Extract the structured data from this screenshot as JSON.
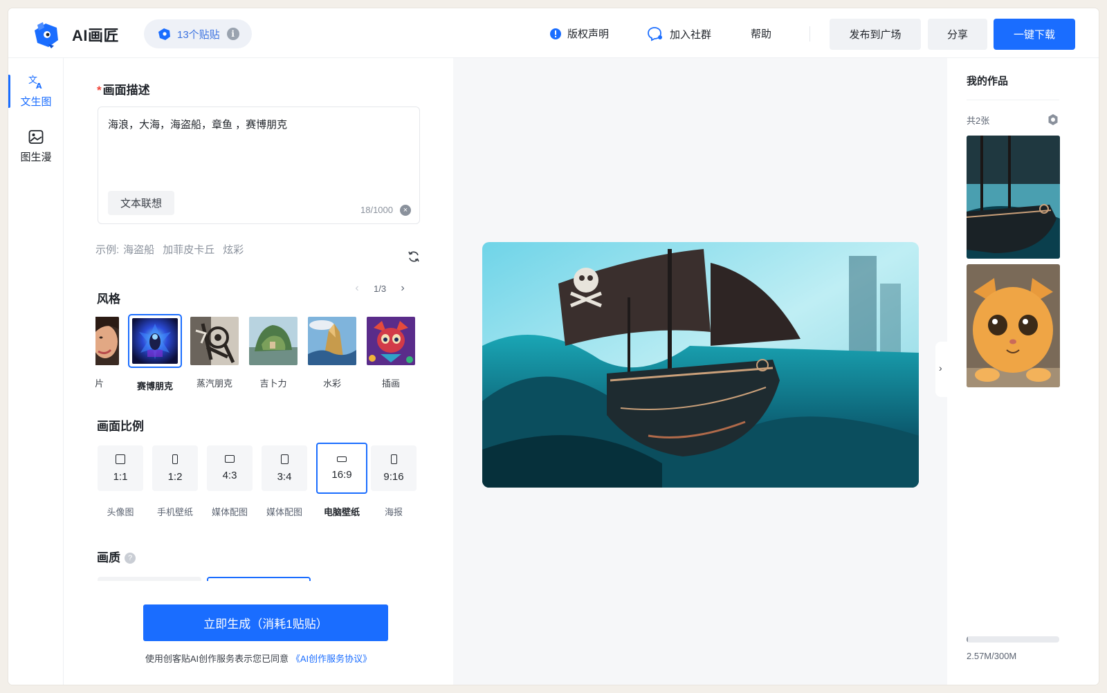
{
  "header": {
    "app_title": "AI画匠",
    "credits_label": "13个贴贴",
    "nav": {
      "copyright": "版权声明",
      "community": "加入社群",
      "help": "帮助"
    },
    "buttons": {
      "publish": "发布到广场",
      "share": "分享",
      "download": "一键下载"
    }
  },
  "rail": {
    "items": [
      {
        "label": "文生图",
        "icon": "translate-icon",
        "active": true
      },
      {
        "label": "图生漫",
        "icon": "image-icon",
        "active": false
      }
    ]
  },
  "prompt": {
    "title": "画面描述",
    "value": "海浪，大海，海盗船，章鱼 ，赛博朋克",
    "assoc_button": "文本联想",
    "counter": "18/1000",
    "clear_glyph": "×"
  },
  "examples": {
    "prefix": "示例:",
    "items": [
      "海盗船",
      "加菲皮卡丘",
      "炫彩"
    ]
  },
  "style": {
    "title": "风格",
    "page": "1/3",
    "prev_glyph": "‹",
    "next_glyph": "›",
    "items": [
      {
        "label": "照片",
        "selected": false
      },
      {
        "label": "赛博朋克",
        "selected": true
      },
      {
        "label": "蒸汽朋克",
        "selected": false
      },
      {
        "label": "吉卜力",
        "selected": false
      },
      {
        "label": "水彩",
        "selected": false
      },
      {
        "label": "插画",
        "selected": false
      }
    ]
  },
  "ratio": {
    "title": "画面比例",
    "items": [
      {
        "value": "1:1",
        "label": "头像图",
        "selected": false
      },
      {
        "value": "1:2",
        "label": "手机壁纸",
        "selected": false
      },
      {
        "value": "4:3",
        "label": "媒体配图",
        "selected": false
      },
      {
        "value": "3:4",
        "label": "媒体配图",
        "selected": false
      },
      {
        "value": "16:9",
        "label": "电脑壁纸",
        "selected": true
      },
      {
        "value": "9:16",
        "label": "海报",
        "selected": false
      }
    ]
  },
  "quality": {
    "title": "画质",
    "help_glyph": "?"
  },
  "generate": {
    "button": "立即生成（消耗1贴贴）",
    "agree_prefix": "使用创客贴AI创作服务表示您已同意",
    "agree_link": "《AI创作服务协议》"
  },
  "gallery": {
    "title": "我的作品",
    "count": "共2张",
    "storage_text": "2.57M/300M",
    "storage_fraction": 0.0086
  },
  "colors": {
    "accent": "#1a6dff",
    "required": "#f04438"
  }
}
